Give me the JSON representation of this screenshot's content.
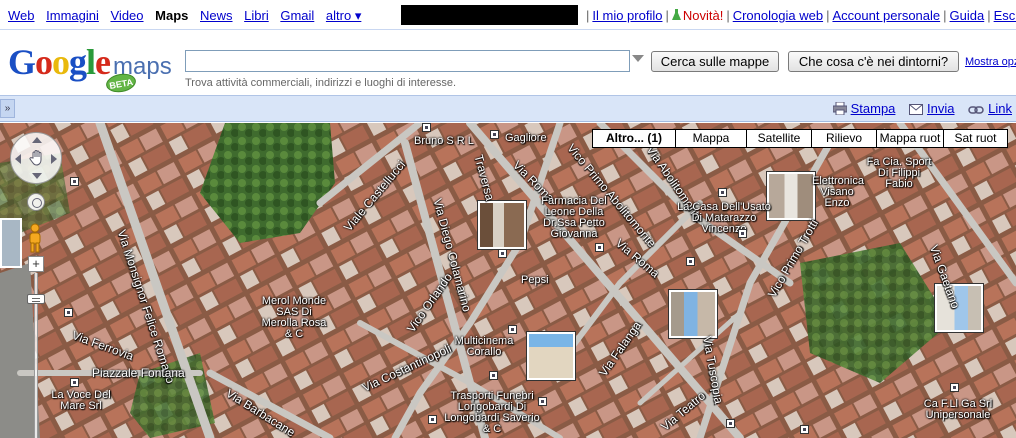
{
  "topnav": {
    "left": [
      "Web",
      "Immagini",
      "Video",
      "Maps",
      "News",
      "Libri",
      "Gmail"
    ],
    "more": "altro ▾",
    "right": {
      "profile": "Il mio profilo",
      "news": "Novità!",
      "history": "Cronologia web",
      "account": "Account personale",
      "help": "Guida",
      "exit": "Esci"
    }
  },
  "logo": {
    "google": "Google",
    "maps": "maps",
    "beta": "BETA"
  },
  "search": {
    "value": "",
    "hint": "Trova attività commerciali, indirizzi e luoghi di interesse.",
    "search_button": "Cerca sulle mappe",
    "nearby_button": "Che cosa c'è nei dintorni?",
    "options_link": "Mostra opz"
  },
  "toolbar": {
    "collapse": "»",
    "print": "Stampa",
    "send": "Invia",
    "link": "Link"
  },
  "map_types": [
    "Altro... (1)",
    "Mappa",
    "Satellite",
    "Rilievo",
    "Mappa ruot",
    "Sat ruot"
  ],
  "map_labels": {
    "roads": [
      "Viale Castellucci",
      "Via Monsignor Felice Romano",
      "Via Diego Colamarino",
      "Traversa",
      "Via Roma",
      "Vico Primo Abolitomonte",
      "Via Abolitomonte",
      "Via Roma",
      "Vico Primo Trotti",
      "Via Gaetano",
      "Vico Orlando",
      "Via Costantinopoli",
      "Via Falanga",
      "Via Teatro",
      "Piazzale Fontana",
      "Via Barbacane",
      "Via Ferrovia",
      "Via Tuscopia"
    ],
    "pois": [
      "Bruno S R L",
      "Gagliore",
      "Farmacia Del Leone Della Dr.Ssa Petto Giovanna",
      "La Casa Dell'Usato Di Matarazzo Vincenzo",
      "Elettronica Visano Enzo",
      "Fa Cia. Sport Di Filippi Fabio",
      "Merol Monde SAS Di Merolla Rosa & C",
      "Multicinema Corallo",
      "Trasporti Funebri Longobardi Di Longobardi Saverio & C",
      "La Voce Del Mare Srl",
      "Ca F.Ll Ga Srl Unipersonale",
      "Pepsi"
    ]
  }
}
